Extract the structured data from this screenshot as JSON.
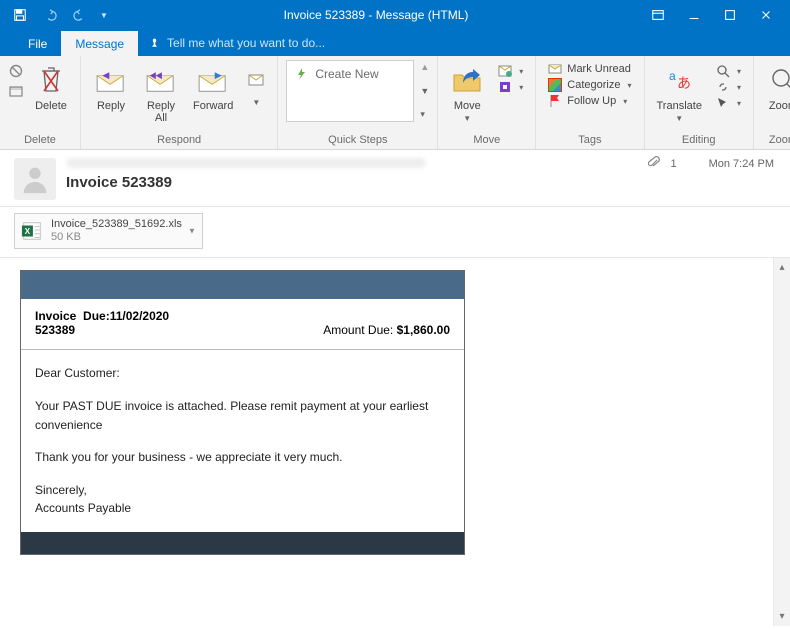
{
  "window": {
    "title": "Invoice 523389 - Message (HTML)"
  },
  "tabs": {
    "file": "File",
    "message": "Message",
    "tell_me": "Tell me what you want to do..."
  },
  "ribbon": {
    "delete": {
      "label": "Delete",
      "group": "Delete"
    },
    "respond": {
      "reply": "Reply",
      "reply_all": "Reply\nAll",
      "forward": "Forward",
      "group": "Respond"
    },
    "quick_steps": {
      "create_new": "Create New",
      "group": "Quick Steps"
    },
    "move": {
      "move": "Move",
      "group": "Move"
    },
    "tags": {
      "mark_unread": "Mark Unread",
      "categorize": "Categorize",
      "follow_up": "Follow Up",
      "group": "Tags"
    },
    "editing": {
      "translate": "Translate",
      "group": "Editing"
    },
    "zoom": {
      "zoom": "Zoom",
      "group": "Zoom"
    }
  },
  "header": {
    "subject": "Invoice 523389",
    "attach_count": "1",
    "timestamp": "Mon 7:24 PM"
  },
  "attachment": {
    "name": "Invoice_523389_51692.xls",
    "size": "50 KB"
  },
  "email": {
    "inv_label": "Invoice",
    "inv_no": "523389",
    "due_label": "Due:",
    "due_date": "11/02/2020",
    "amt_label": "Amount Due:",
    "amt": "$1,860.00",
    "greeting": "Dear Customer:",
    "p1": "Your PAST DUE invoice is attached. Please remit payment at your earliest convenience",
    "p2": "Thank you for your business - we appreciate it very much.",
    "sign1": "Sincerely,",
    "sign2": "Accounts Payable"
  }
}
